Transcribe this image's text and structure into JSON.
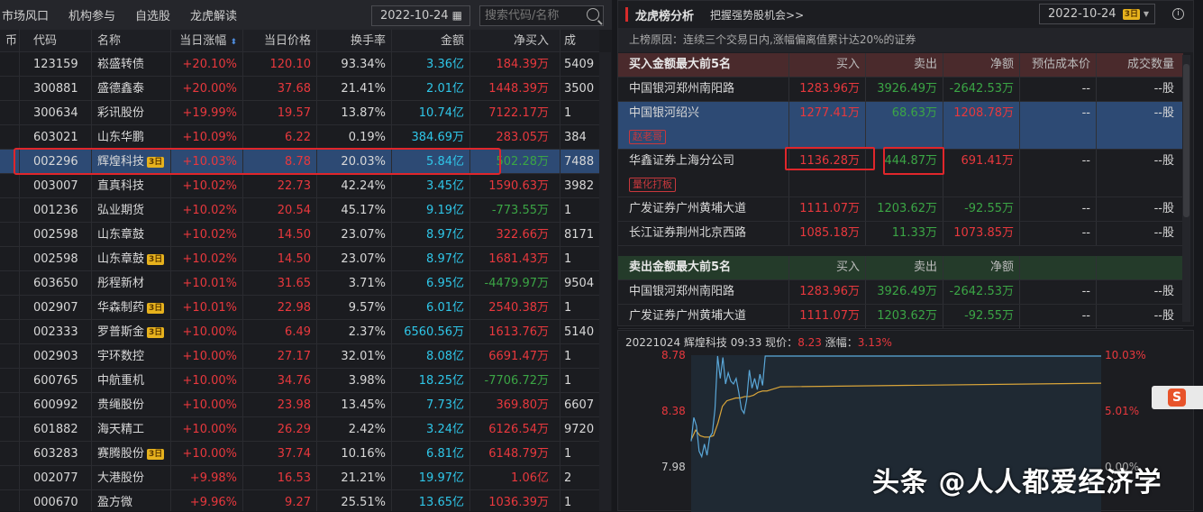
{
  "left": {
    "tabs": [
      "市场风口",
      "机构参与",
      "自选股",
      "龙虎解读"
    ],
    "date": "2022-10-24",
    "search_placeholder": "搜索代码/名称",
    "headers": [
      "币",
      "代码",
      "名称",
      "当日涨幅",
      "当日价格",
      "换手率",
      "金额",
      "净买入",
      "成"
    ],
    "rows": [
      {
        "code": "123159",
        "name": "崧盛转债",
        "badge": "",
        "chg": "+20.10%",
        "price": "120.10",
        "turn": "93.34%",
        "amt": "3.36亿",
        "net": "184.39万",
        "net_color": "red",
        "extra": "5409"
      },
      {
        "code": "300881",
        "name": "盛德鑫泰",
        "badge": "",
        "chg": "+20.00%",
        "price": "37.68",
        "turn": "21.41%",
        "amt": "2.01亿",
        "net": "1448.39万",
        "net_color": "red",
        "extra": "3500"
      },
      {
        "code": "300634",
        "name": "彩讯股份",
        "badge": "",
        "chg": "+19.99%",
        "price": "19.57",
        "turn": "13.87%",
        "amt": "10.74亿",
        "net": "7122.17万",
        "net_color": "red",
        "extra": "1"
      },
      {
        "code": "603021",
        "name": "山东华鹏",
        "badge": "",
        "chg": "+10.09%",
        "price": "6.22",
        "turn": "0.19%",
        "amt": "384.69万",
        "net": "283.05万",
        "net_color": "red",
        "extra": "384"
      },
      {
        "code": "002296",
        "name": "辉煌科技",
        "badge": "3日",
        "chg": "+10.03%",
        "price": "8.78",
        "turn": "20.03%",
        "amt": "5.84亿",
        "net": "502.28万",
        "net_color": "green",
        "extra": "7488",
        "selected": true
      },
      {
        "code": "003007",
        "name": "直真科技",
        "badge": "",
        "chg": "+10.02%",
        "price": "22.73",
        "turn": "42.24%",
        "amt": "3.45亿",
        "net": "1590.63万",
        "net_color": "red",
        "extra": "3982"
      },
      {
        "code": "001236",
        "name": "弘业期货",
        "badge": "",
        "chg": "+10.02%",
        "price": "20.54",
        "turn": "45.17%",
        "amt": "9.19亿",
        "net": "-773.55万",
        "net_color": "green",
        "extra": "1"
      },
      {
        "code": "002598",
        "name": "山东章鼓",
        "badge": "",
        "chg": "+10.02%",
        "price": "14.50",
        "turn": "23.07%",
        "amt": "8.97亿",
        "net": "322.66万",
        "net_color": "red",
        "extra": "8171"
      },
      {
        "code": "002598",
        "name": "山东章鼓",
        "badge": "3日",
        "chg": "+10.02%",
        "price": "14.50",
        "turn": "23.07%",
        "amt": "8.97亿",
        "net": "1681.43万",
        "net_color": "red",
        "extra": "1"
      },
      {
        "code": "603650",
        "name": "彤程新材",
        "badge": "",
        "chg": "+10.01%",
        "price": "31.65",
        "turn": "3.71%",
        "amt": "6.95亿",
        "net": "-4479.97万",
        "net_color": "green",
        "extra": "9504"
      },
      {
        "code": "002907",
        "name": "华森制药",
        "badge": "3日",
        "chg": "+10.01%",
        "price": "22.98",
        "turn": "9.57%",
        "amt": "6.01亿",
        "net": "2540.38万",
        "net_color": "red",
        "extra": "1"
      },
      {
        "code": "002333",
        "name": "罗普斯金",
        "badge": "3日",
        "chg": "+10.00%",
        "price": "6.49",
        "turn": "2.37%",
        "amt": "6560.56万",
        "net": "1613.76万",
        "net_color": "red",
        "extra": "5140"
      },
      {
        "code": "002903",
        "name": "宇环数控",
        "badge": "",
        "chg": "+10.00%",
        "price": "27.17",
        "turn": "32.01%",
        "amt": "8.08亿",
        "net": "6691.47万",
        "net_color": "red",
        "extra": "1"
      },
      {
        "code": "600765",
        "name": "中航重机",
        "badge": "",
        "chg": "+10.00%",
        "price": "34.76",
        "turn": "3.98%",
        "amt": "18.25亿",
        "net": "-7706.72万",
        "net_color": "green",
        "extra": "1"
      },
      {
        "code": "600992",
        "name": "贵绳股份",
        "badge": "",
        "chg": "+10.00%",
        "price": "23.98",
        "turn": "13.45%",
        "amt": "7.73亿",
        "net": "369.80万",
        "net_color": "red",
        "extra": "6607"
      },
      {
        "code": "601882",
        "name": "海天精工",
        "badge": "",
        "chg": "+10.00%",
        "price": "26.29",
        "turn": "2.42%",
        "amt": "3.24亿",
        "net": "6126.54万",
        "net_color": "red",
        "extra": "9720"
      },
      {
        "code": "603283",
        "name": "赛腾股份",
        "badge": "3日",
        "chg": "+10.00%",
        "price": "37.74",
        "turn": "10.16%",
        "amt": "6.81亿",
        "net": "6148.79万",
        "net_color": "red",
        "extra": "1"
      },
      {
        "code": "002077",
        "name": "大港股份",
        "badge": "",
        "chg": "+9.98%",
        "price": "16.53",
        "turn": "21.21%",
        "amt": "19.97亿",
        "net": "1.06亿",
        "net_color": "red",
        "extra": "2"
      },
      {
        "code": "000670",
        "name": "盈方微",
        "badge": "",
        "chg": "+9.96%",
        "price": "9.27",
        "turn": "25.51%",
        "amt": "13.65亿",
        "net": "1036.39万",
        "net_color": "red",
        "extra": "1"
      }
    ]
  },
  "right": {
    "title": "龙虎榜分析",
    "link": "把握强势股机会>>",
    "date": "2022-10-24",
    "date_badge": "3日",
    "info_icon": "i",
    "reason": "上榜原因：连续三个交易日内,涨幅偏离值累计达20%的证券",
    "buy_header": [
      "买入金额最大前5名",
      "买入",
      "卖出",
      "净额",
      "预估成本价",
      "成交数量"
    ],
    "buy_rows": [
      {
        "name": "中国银河郑州南阳路",
        "tag": "",
        "buy": "1283.96万",
        "sell": "3926.49万",
        "net": "-2642.53万",
        "net_color": "green",
        "cost": "--",
        "qty": "--股"
      },
      {
        "name": "中国银河绍兴",
        "tag": "赵老哥",
        "buy": "1277.41万",
        "sell": "68.63万",
        "net": "1208.78万",
        "net_color": "red",
        "cost": "--",
        "qty": "--股",
        "selected": true
      },
      {
        "name": "华鑫证券上海分公司",
        "tag": "量化打板",
        "buy": "1136.28万",
        "sell": "444.87万",
        "net": "691.41万",
        "net_color": "red",
        "cost": "--",
        "qty": "--股"
      },
      {
        "name": "广发证券广州黄埔大道",
        "tag": "",
        "buy": "1111.07万",
        "sell": "1203.62万",
        "net": "-92.55万",
        "net_color": "green",
        "cost": "--",
        "qty": "--股"
      },
      {
        "name": "长江证券荆州北京西路",
        "tag": "",
        "buy": "1085.18万",
        "sell": "11.33万",
        "net": "1073.85万",
        "net_color": "red",
        "cost": "--",
        "qty": "--股"
      }
    ],
    "sell_header": [
      "卖出金额最大前5名",
      "买入",
      "卖出",
      "净额",
      "",
      ""
    ],
    "sell_rows": [
      {
        "name": "中国银河郑州南阳路",
        "tag": "",
        "buy": "1283.96万",
        "sell": "3926.49万",
        "net": "-2642.53万",
        "net_color": "green",
        "cost": "--",
        "qty": "--股"
      },
      {
        "name": "广发证券广州黄埔大道",
        "tag": "",
        "buy": "1111.07万",
        "sell": "1203.62万",
        "net": "-92.55万",
        "net_color": "green",
        "cost": "--",
        "qty": "--股"
      }
    ]
  },
  "chart": {
    "date": "20221024",
    "name": "辉煌科技",
    "time": "09:33",
    "price_label": "现价：",
    "price": "8.23",
    "chg_label": "涨幅：",
    "chg": "3.13%",
    "y_left": [
      "8.78",
      "8.38",
      "7.98"
    ],
    "y_right": [
      "10.03%",
      "5.01%",
      "0.00%"
    ],
    "price_series": [
      8.17,
      8.34,
      8.28,
      8.1,
      8.06,
      8.15,
      8.07,
      8.2,
      8.23,
      8.4,
      8.78,
      8.62,
      8.77,
      8.58,
      8.66,
      8.6,
      8.58,
      8.62,
      8.52,
      8.4,
      8.37,
      8.47,
      8.68,
      8.55,
      8.62,
      8.54,
      8.65,
      8.57,
      8.78,
      8.78,
      8.78,
      8.78
    ],
    "avg_series": [
      8.18,
      8.25,
      8.21,
      8.2,
      8.2,
      8.21,
      8.3,
      8.42,
      8.46,
      8.47,
      8.48,
      8.48,
      8.49,
      8.49,
      8.5,
      8.52,
      8.53,
      8.53,
      8.54,
      8.55,
      8.56
    ]
  },
  "watermark": "头条 @人人都爱经济学",
  "ime_icon": "S",
  "colors": {
    "red": "#e8383d",
    "green": "#3ba545",
    "cyan": "#2fc6e8",
    "price_line": "#5aa7d8",
    "avg_line": "#d9a53a"
  }
}
